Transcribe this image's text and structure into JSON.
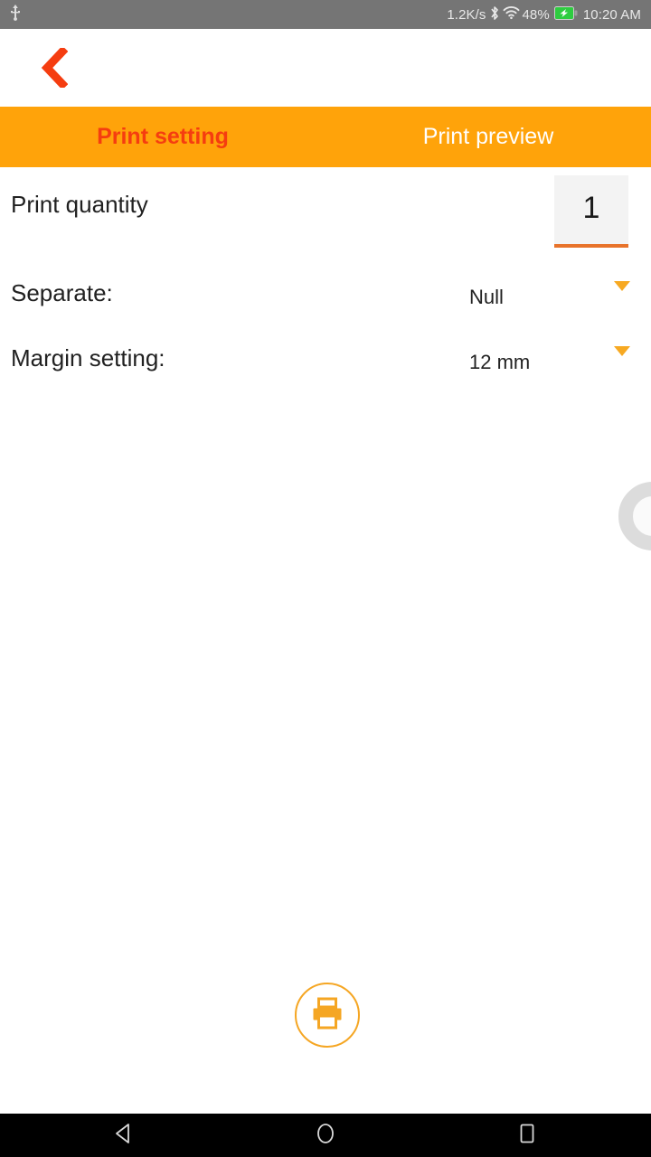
{
  "statusbar": {
    "usb_icon": "usb-icon",
    "network_speed": "1.2K/s",
    "bluetooth_icon": "bluetooth-icon",
    "wifi_icon": "wifi-icon",
    "battery_percent": "48%",
    "battery_icon": "battery-charging-icon",
    "clock": "10:20 AM",
    "background_color": "#757575",
    "text_color": "#e8e8e8",
    "battery_color": "#2ecc40"
  },
  "appbar": {
    "back_icon": "chevron-left-icon",
    "back_color": "#F53D10"
  },
  "tabs": [
    {
      "label": "Print setting",
      "active": true
    },
    {
      "label": "Print preview",
      "active": false
    }
  ],
  "tabbar": {
    "background_color": "#FFA30A",
    "active_text_color": "#F53D10",
    "inactive_text_color": "#ffffff"
  },
  "settings": {
    "print_quantity": {
      "label": "Print quantity",
      "value": "1",
      "placeholder": "1",
      "field_background": "#f3f3f3",
      "underline_color": "#E8732B"
    },
    "separate": {
      "label": "Separate:",
      "value": "Null",
      "arrow_icon": "chevron-down-icon"
    },
    "margin_setting": {
      "label": "Margin setting:",
      "value": "12 mm",
      "arrow_icon": "chevron-down-icon"
    }
  },
  "edge_handle": {
    "icon": "circle-ring-handle",
    "color": "#dcdcdc"
  },
  "print_action": {
    "icon": "printer-icon",
    "color": "#F5A623"
  },
  "navbar": {
    "back_icon": "nav-back-triangle-icon",
    "home_icon": "nav-home-circle-icon",
    "recents_icon": "nav-recents-square-icon",
    "background_color": "#000000"
  }
}
